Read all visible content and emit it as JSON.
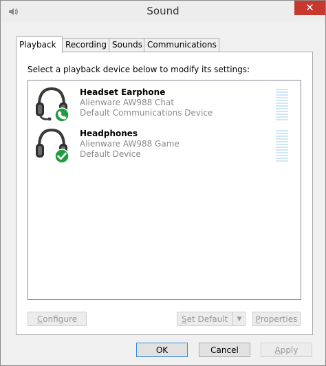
{
  "window": {
    "title": "Sound",
    "close_symbol": "✕",
    "icon": "speaker-icon",
    "colors": {
      "close_button": "#c7382f",
      "chrome": "#ededed",
      "face": "#f0f0f0"
    }
  },
  "tabs": [
    {
      "label": "Playback",
      "active": true
    },
    {
      "label": "Recording",
      "active": false
    },
    {
      "label": "Sounds",
      "active": false
    },
    {
      "label": "Communications",
      "active": false
    }
  ],
  "playback": {
    "instruction": "Select a playback device below to modify its settings:",
    "devices": [
      {
        "name": "Headset Earphone",
        "model": "Alienware AW988 Chat",
        "status": "Default Communications Device",
        "icon": "headset-icon",
        "badge_icon": "phone-badge-icon",
        "badge_color": "#1e9e3e"
      },
      {
        "name": "Headphones",
        "model": "Alienware AW988 Game",
        "status": "Default Device",
        "icon": "headphones-icon",
        "badge_icon": "checkmark-badge-icon",
        "badge_color": "#1e9e3e"
      }
    ],
    "buttons": {
      "configure_prefix": "",
      "configure_key": "C",
      "configure_rest": "onfigure",
      "set_default_prefix": "",
      "set_default_key": "S",
      "set_default_rest": "et Default",
      "set_default_arrow": "▼",
      "properties_prefix": "",
      "properties_key": "P",
      "properties_rest": "roperties"
    }
  },
  "footer": {
    "ok": "OK",
    "cancel": "Cancel",
    "apply_prefix": "",
    "apply_key": "A",
    "apply_rest": "pply"
  }
}
